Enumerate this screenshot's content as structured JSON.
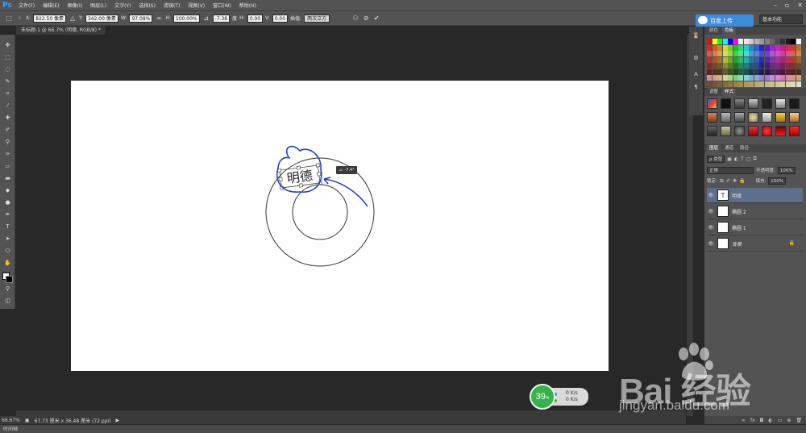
{
  "app": {
    "logo": "Ps"
  },
  "menu": [
    "文件(F)",
    "编辑(E)",
    "图像(I)",
    "图层(L)",
    "文字(Y)",
    "选择(S)",
    "滤镜(T)",
    "视图(V)",
    "窗口(W)",
    "帮助(H)"
  ],
  "options": {
    "x_label": "X:",
    "x_value": "822.50 像素",
    "y_label": "Y:",
    "y_value": "342.00 像素",
    "w_label": "W:",
    "w_value": "97.08%",
    "h_label": "H:",
    "h_value": "100.00%",
    "angle_value": "-7.38",
    "angle_unit": "度",
    "hskew_label": "H:",
    "hskew_value": "0.00",
    "vskew_label": "V:",
    "vskew_value": "0.00",
    "interp_label": "插值:",
    "interp_value": "两次立方"
  },
  "baidu_upload": "百度上传",
  "workspace": "基本功能",
  "document_tab": "未标题-1 @ 66.7% (明德, RGB/8) *",
  "canvas": {
    "transform_text": "明德",
    "angle_tooltip": "⊿: -7.4°"
  },
  "status": {
    "zoom": "66.67%",
    "doc_info": "67.73 厘米 x 36.48 厘米 (72 ppi)"
  },
  "timeline": "时间轴",
  "panels": {
    "color_tabs": [
      "颜色",
      "色板"
    ],
    "style_tabs": [
      "调整",
      "样式"
    ],
    "layer_tabs": [
      "图层",
      "通道",
      "路径"
    ],
    "kind": "ρ 类型",
    "blend_mode": "正常",
    "opacity_label": "不透明度:",
    "opacity_value": "100%",
    "lock_label": "锁定:",
    "fill_label": "填充:",
    "fill_value": "100%",
    "layers": [
      {
        "name": "明德",
        "thumb": "T"
      },
      {
        "name": "椭圆 2",
        "thumb": ""
      },
      {
        "name": "椭圆 1",
        "thumb": ""
      },
      {
        "name": "背景",
        "thumb": ""
      }
    ]
  },
  "net_widget": {
    "percent": "39",
    "percent_unit": "%",
    "up": "0 K/s",
    "down": "0 K/s"
  },
  "watermark": {
    "brand": "Bai  经验",
    "url": "jingyan.baidu.com"
  }
}
